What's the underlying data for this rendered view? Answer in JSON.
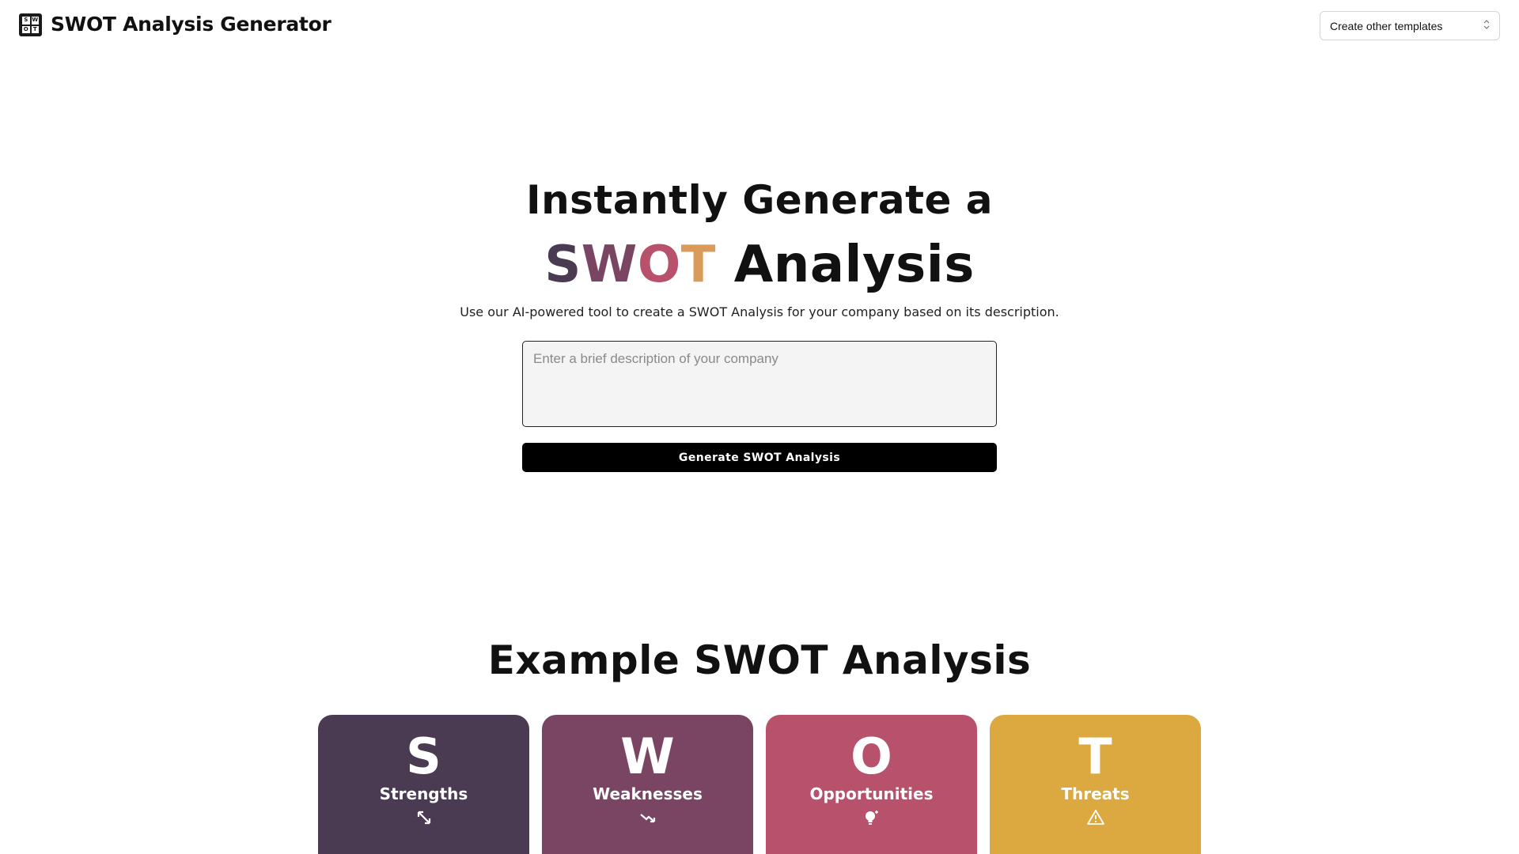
{
  "header": {
    "logo_letters": [
      "S",
      "W",
      "O",
      "T"
    ],
    "title": "SWOT Analysis Generator",
    "template_select_label": "Create other templates"
  },
  "hero": {
    "line1": "Instantly Generate a",
    "swot_letters": [
      {
        "char": "S",
        "color": "#4a3a52"
      },
      {
        "char": "W",
        "color": "#7a4562"
      },
      {
        "char": "O",
        "color": "#b7516c"
      },
      {
        "char": "T",
        "color": "#d99a5a"
      }
    ],
    "line2_rest": "Analysis",
    "subtitle": "Use our AI-powered tool to create a SWOT Analysis for your company based on its description."
  },
  "form": {
    "description_value": "",
    "description_placeholder": "Enter a brief description of your company",
    "generate_button": "Generate SWOT Analysis"
  },
  "example": {
    "title": "Example SWOT Analysis",
    "cards": [
      {
        "letter": "S",
        "label": "Strengths",
        "icon": "arrows-expand-icon",
        "color": "#4a3a52"
      },
      {
        "letter": "W",
        "label": "Weaknesses",
        "icon": "trend-down-icon",
        "color": "#7a4562"
      },
      {
        "letter": "O",
        "label": "Opportunities",
        "icon": "lightbulb-icon",
        "color": "#b7516c"
      },
      {
        "letter": "T",
        "label": "Threats",
        "icon": "warning-icon",
        "color": "#dba93f"
      }
    ]
  }
}
